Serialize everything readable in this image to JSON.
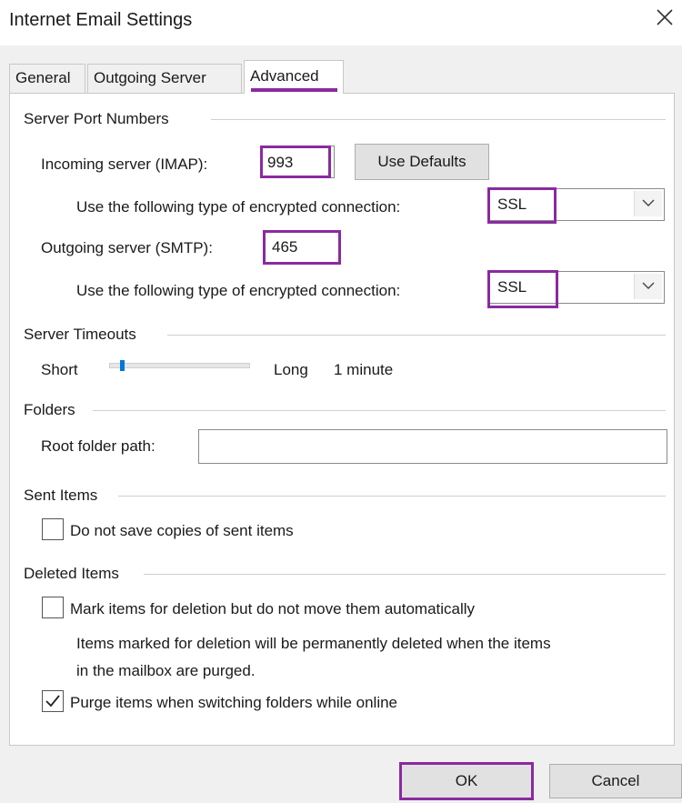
{
  "window": {
    "title": "Internet Email Settings"
  },
  "tabs": [
    {
      "label": "General",
      "active": false
    },
    {
      "label": "Outgoing Server",
      "active": false
    },
    {
      "label": "Advanced",
      "active": true
    }
  ],
  "server_ports": {
    "group_label": "Server Port Numbers",
    "incoming_label": "Incoming server (IMAP):",
    "incoming_value": "993",
    "use_defaults_label": "Use Defaults",
    "encryption_label": "Use the following type of encrypted connection:",
    "incoming_encryption": "SSL",
    "outgoing_label": "Outgoing server (SMTP):",
    "outgoing_value": "465",
    "outgoing_encryption": "SSL"
  },
  "timeouts": {
    "group_label": "Server Timeouts",
    "short_label": "Short",
    "long_label": "Long",
    "value_label": "1 minute",
    "slider_level_fraction": 0.08
  },
  "folders": {
    "group_label": "Folders",
    "root_label": "Root folder path:",
    "root_value": ""
  },
  "sent_items": {
    "group_label": "Sent Items",
    "do_not_save_label": "Do not save copies of sent items",
    "do_not_save_checked": false
  },
  "deleted_items": {
    "group_label": "Deleted Items",
    "mark_label": "Mark items for deletion but do not move them automatically",
    "mark_checked": false,
    "note_line1": "Items marked for deletion will be permanently deleted when the items",
    "note_line2": "in the mailbox are purged.",
    "purge_label": "Purge items when switching folders while online",
    "purge_checked": true
  },
  "buttons": {
    "ok": "OK",
    "cancel": "Cancel"
  },
  "colors": {
    "highlight": "#8a2aa0",
    "slider_thumb": "#0078d7"
  },
  "icons": {
    "close": "close-icon",
    "dropdown": "chevron-down-icon",
    "check": "checkmark-icon"
  }
}
